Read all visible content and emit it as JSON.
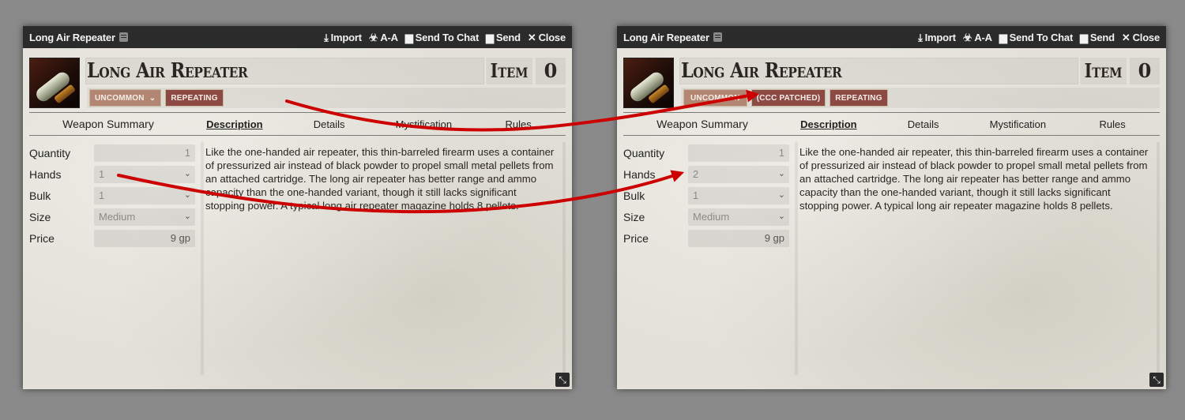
{
  "colors": {
    "arrow": "#cc0000",
    "titlebar": "#2b2b2b",
    "rarity_tag": "#b38673",
    "trait_tag": "#8d4a45"
  },
  "before": {
    "window_title": "Long Air Repeater",
    "actions": {
      "import": "Import",
      "aa": "A-A",
      "send_to_chat": "Send To Chat",
      "send": "Send",
      "close": "Close"
    },
    "item_name": "Long Air Repeater",
    "item_type": "Item",
    "item_level": "0",
    "tags": {
      "rarity": "UNCOMMON",
      "trait1": "REPEATING"
    },
    "nav": {
      "summary": "Weapon Summary",
      "tabs": [
        "Description",
        "Details",
        "Mystification",
        "Rules"
      ]
    },
    "fields": {
      "quantity_label": "Quantity",
      "quantity_value": "1",
      "hands_label": "Hands",
      "hands_value": "1",
      "bulk_label": "Bulk",
      "bulk_value": "1",
      "size_label": "Size",
      "size_value": "Medium",
      "price_label": "Price",
      "price_value": "9 gp"
    },
    "description": "Like the one-handed air repeater, this thin-barreled firearm uses a container of pressurized air instead of black powder to propel small metal pellets from an attached cartridge. The long air repeater has better range and ammo capacity than the one-handed variant, though it still lacks significant stopping power. A typical long air repeater magazine holds 8 pellets."
  },
  "after": {
    "window_title": "Long Air Repeater",
    "actions": {
      "import": "Import",
      "aa": "A-A",
      "send_to_chat": "Send To Chat",
      "send": "Send",
      "close": "Close"
    },
    "item_name": "Long Air Repeater",
    "item_type": "Item",
    "item_level": "0",
    "tags": {
      "rarity": "UNCOMMON",
      "trait1": "(CCC PATCHED)",
      "trait2": "REPEATING"
    },
    "nav": {
      "summary": "Weapon Summary",
      "tabs": [
        "Description",
        "Details",
        "Mystification",
        "Rules"
      ]
    },
    "fields": {
      "quantity_label": "Quantity",
      "quantity_value": "1",
      "hands_label": "Hands",
      "hands_value": "2",
      "bulk_label": "Bulk",
      "bulk_value": "1",
      "size_label": "Size",
      "size_value": "Medium",
      "price_label": "Price",
      "price_value": "9 gp"
    },
    "description": "Like the one-handed air repeater, this thin-barreled firearm uses a container of pressurized air instead of black powder to propel small metal pellets from an attached cartridge. The long air repeater has better range and ammo capacity than the one-handed variant, though it still lacks significant stopping power. A typical long air repeater magazine holds 8 pellets."
  }
}
